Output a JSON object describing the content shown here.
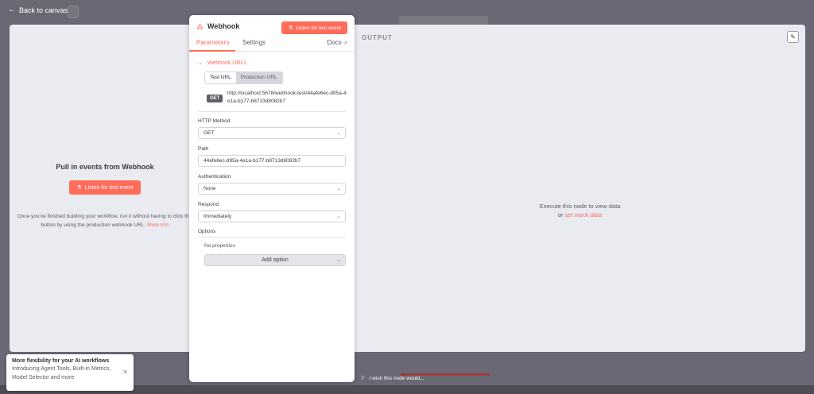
{
  "topbar": {
    "back_label": "Back to canvas"
  },
  "input_panel": {
    "title": "Pull in events from Webhook",
    "listen_button": "Listen for test event",
    "description": "Once you've finished building your workflow, run it without having to click this button by using the production webhook URL.",
    "more_info": "More info"
  },
  "node": {
    "title": "Webhook",
    "listen_button": "Listen for test event",
    "tabs": [
      "Parameters",
      "Settings"
    ],
    "docs": "Docs",
    "webhook_urls": {
      "label": "Webhook URLs",
      "tabs": [
        "Test URL",
        "Production URL"
      ],
      "method": "GET",
      "url": "http://localhost:5678/webhook-test/44afe6ec-d95a-4e1a-b177-b8713d8082b7"
    },
    "http_method": {
      "label": "HTTP Method",
      "value": "GET"
    },
    "path": {
      "label": "Path",
      "value": "44afe6ec-d95a-4e1a-b177-b8713d8082b7"
    },
    "authentication": {
      "label": "Authentication",
      "value": "None"
    },
    "respond": {
      "label": "Respond",
      "value": "Immediately"
    },
    "options": {
      "label": "Options",
      "empty": "No properties",
      "add_button": "Add option"
    }
  },
  "output_panel": {
    "label": "OUTPUT",
    "message_line1": "Execute this node to view data",
    "message_or": "or",
    "mock_link": "set mock data"
  },
  "toast": {
    "title": "More flexibility for your AI workflows",
    "body": "Introducing Agent Tools, Built-in Metrics, Model Selector and more"
  },
  "feedback": {
    "text": "I wish this node would..."
  },
  "colors": {
    "accent": "#ff6d5a",
    "panel_bg": "#e9ebf1",
    "backdrop": "#6b6875"
  }
}
